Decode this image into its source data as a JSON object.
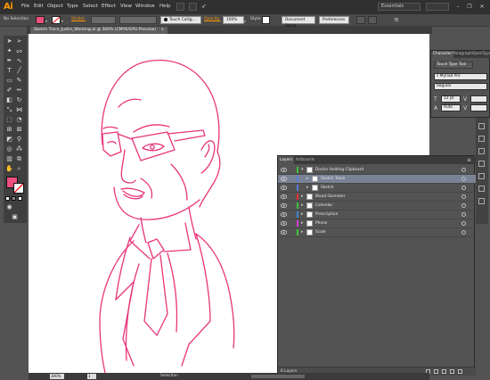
{
  "app": {
    "logo": "Ai"
  },
  "menu": [
    "File",
    "Edit",
    "Object",
    "Type",
    "Select",
    "Effect",
    "View",
    "Window",
    "Help"
  ],
  "workspace": "Essentials",
  "window_controls": {
    "minimize": "–",
    "restore": "❐",
    "close": "✕"
  },
  "controlbar": {
    "selection_label": "No Selection",
    "stroke_label": "Stroke:",
    "brush_label": "Touch Callig...",
    "opacity_label": "Opacity:",
    "opacity_value": "100%",
    "style_label": "Style:",
    "doc_setup": "Document Setup",
    "preferences": "Preferences"
  },
  "document_tab": {
    "title": "Sketch Trace_Justin_Working.ai @ 300% (CMYK/GPU Preview)",
    "close": "×"
  },
  "character_panel": {
    "tabs": [
      "Character",
      "Paragraph",
      "OpenType"
    ],
    "type_tool": "Touch Type Tool",
    "font": "Myriad Pro",
    "style": "Regular",
    "size": "12 pt",
    "leading": "Auto"
  },
  "layers_panel": {
    "tabs": [
      "Layers",
      "Artboards"
    ],
    "layers": [
      {
        "name": "Doctor Holding Clipboard",
        "expanded": true,
        "color": "#3dc23d",
        "indent": 0
      },
      {
        "name": "Sketch Trace",
        "expanded": false,
        "color": "#5a7ad6",
        "indent": 1,
        "selected": true
      },
      {
        "name": "Sketch",
        "expanded": false,
        "color": "#5a7ad6",
        "indent": 1
      },
      {
        "name": "Blood Oximeter",
        "expanded": false,
        "color": "#e03030",
        "indent": 0
      },
      {
        "name": "Calendar",
        "expanded": false,
        "color": "#3dc23d",
        "indent": 0
      },
      {
        "name": "Prescription",
        "expanded": false,
        "color": "#3d86d6",
        "indent": 0
      },
      {
        "name": "Phone",
        "expanded": false,
        "color": "#d63dd6",
        "indent": 0
      },
      {
        "name": "Scale",
        "expanded": false,
        "color": "#3dc23d",
        "indent": 0
      }
    ],
    "footer_count": "6 Layers"
  },
  "statusbar": {
    "zoom": "300%",
    "page": "1",
    "tool": "Selection"
  },
  "colors": {
    "stroke_line": "#e8357a",
    "fill_swatch": "#ee4f7e"
  }
}
